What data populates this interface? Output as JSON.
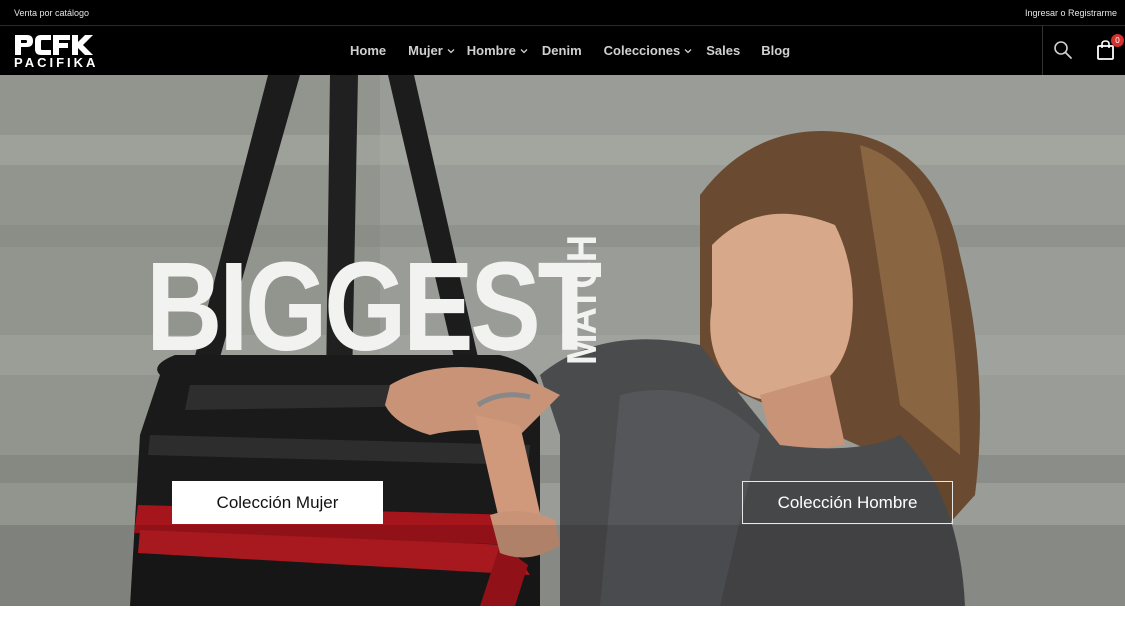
{
  "topbar": {
    "left_text": "Venta por catálogo",
    "right_text": "Ingresar o Registrarme"
  },
  "brand": {
    "mark": "PCFK",
    "name": "PACIFIKA"
  },
  "nav": {
    "items": [
      {
        "label": "Home",
        "has_dropdown": false
      },
      {
        "label": "Mujer",
        "has_dropdown": true
      },
      {
        "label": "Hombre",
        "has_dropdown": true
      },
      {
        "label": "Denim",
        "has_dropdown": false
      },
      {
        "label": "Colecciones",
        "has_dropdown": true
      },
      {
        "label": "Sales",
        "has_dropdown": false
      },
      {
        "label": "Blog",
        "has_dropdown": false
      }
    ],
    "cart_count": "0",
    "icons": {
      "search": "search-icon",
      "cart": "shopping-bag-icon"
    }
  },
  "hero": {
    "headline": "BIGGEST",
    "headline_side": "MATCH",
    "cta_left": "Colección Mujer",
    "cta_right": "Colección Hombre"
  },
  "colors": {
    "header_bg": "#000000",
    "accent_red": "#d5302b",
    "hero_text": "#f2f2f0"
  }
}
